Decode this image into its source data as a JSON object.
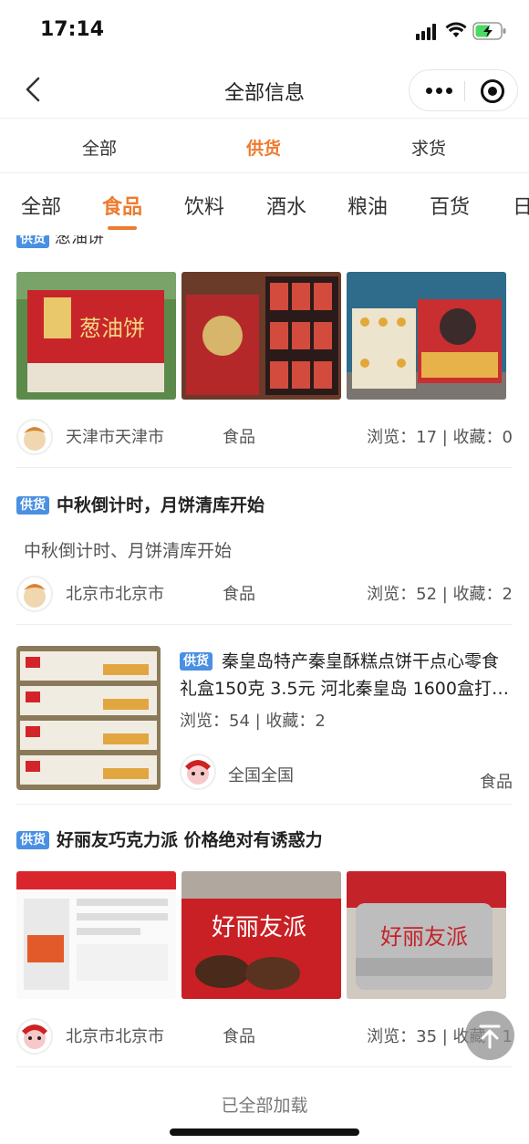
{
  "status_bar": {
    "time": "17:14"
  },
  "navbar": {
    "title": "全部信息"
  },
  "primary_tabs": [
    "全部",
    "供货",
    "求货"
  ],
  "primary_active": 1,
  "secondary_tabs": [
    "全部",
    "食品",
    "饮料",
    "酒水",
    "粮油",
    "百货",
    "日"
  ],
  "secondary_active": 1,
  "badge_label": "供货",
  "posts": [
    {
      "title_cut": "葱油饼",
      "location": "天津市天津市",
      "category": "食品",
      "stats": "浏览：17 | 收藏：0"
    },
    {
      "title": "中秋倒计时，月饼清库开始",
      "desc": "中秋倒计时、月饼清库开始",
      "location": "北京市北京市",
      "category": "食品",
      "stats": "浏览：52 | 收藏：2"
    },
    {
      "title": "秦皇岛特产秦皇酥糕点饼干点心零食礼盒150克 3.5元 河北秦皇岛 1600盒打…",
      "stats": "浏览：54 | 收藏：2",
      "location": "全国全国",
      "category": "食品"
    },
    {
      "title": "好丽友巧克力派 价格绝对有诱惑力",
      "location": "北京市北京市",
      "category": "食品",
      "stats": "浏览：35 | 收藏：1"
    }
  ],
  "footer": "已全部加载",
  "colors": {
    "accent": "#ee7b2f",
    "badge": "#4a90e2"
  }
}
